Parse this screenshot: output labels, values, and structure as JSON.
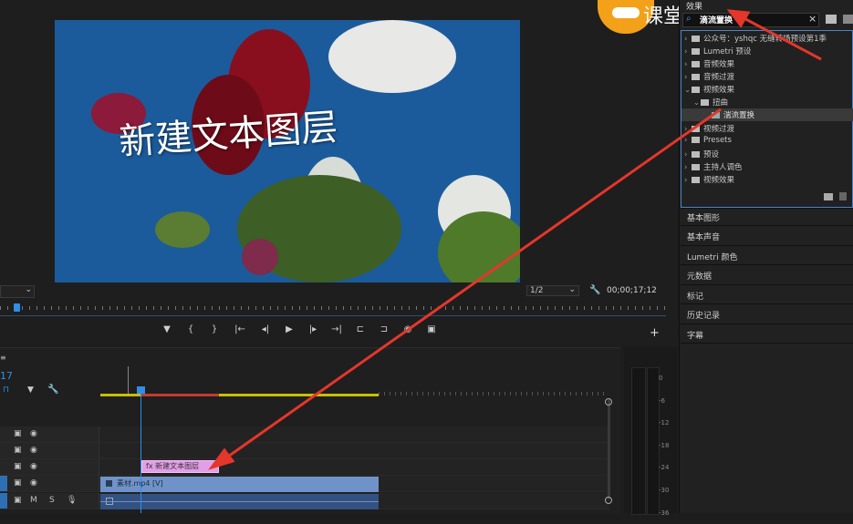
{
  "monitor": {
    "overlay_title": "新建文本图层",
    "zoom_left": "",
    "resolution": "1/2",
    "timecode": "00;00;17;12",
    "watermark_text": "课堂"
  },
  "transport": {
    "icons": [
      "marker-icon",
      "in-point-icon",
      "out-point-icon",
      "go-to-in-icon",
      "step-back-icon",
      "play-icon",
      "step-forward-icon",
      "go-to-out-icon",
      "lift-icon",
      "extract-icon",
      "export-frame-icon",
      "compare-icon"
    ],
    "add_label": "+"
  },
  "timeline": {
    "timecode_partial": "17",
    "tracks": [
      {
        "name": "V3"
      },
      {
        "name": "V2"
      },
      {
        "name": "V1"
      },
      {
        "name": "A1"
      }
    ],
    "title_clip_label": "新建文本图层",
    "video_clip_label": "素材.mp4 [V]",
    "audio_labels": {
      "m": "M",
      "s": "S"
    }
  },
  "meter": {
    "labels": [
      "0",
      "-6",
      "-12",
      "-18",
      "-24",
      "-30",
      "-36"
    ]
  },
  "effects_panel": {
    "tab_label": "效果",
    "search_value": "滴流置换",
    "clear_label": "×",
    "tree": [
      {
        "label": "公众号：yshqc 无缝转场预设第1季",
        "indent": 0,
        "expanded": false
      },
      {
        "label": "Lumetri 预设",
        "indent": 0,
        "expanded": false
      },
      {
        "label": "音频效果",
        "indent": 0,
        "expanded": false
      },
      {
        "label": "音频过渡",
        "indent": 0,
        "expanded": false
      },
      {
        "label": "视频效果",
        "indent": 0,
        "expanded": true
      },
      {
        "label": "扭曲",
        "indent": 1,
        "expanded": true
      },
      {
        "label": "湍流置换",
        "indent": 2,
        "expanded": false,
        "selected": true
      },
      {
        "label": "视频过渡",
        "indent": 0,
        "expanded": false
      },
      {
        "label": "Presets",
        "indent": 0,
        "expanded": false
      },
      {
        "label": "预设",
        "indent": 0,
        "expanded": false
      },
      {
        "label": "主持人调色",
        "indent": 0,
        "expanded": false
      },
      {
        "label": "视频效果",
        "indent": 0,
        "expanded": false
      }
    ],
    "panels": [
      "基本图形",
      "基本声音",
      "Lumetri 颜色",
      "元数据",
      "标记",
      "历史记录",
      "字幕"
    ]
  },
  "colors": {
    "accent": "#2f8ee8",
    "title_clip": "#e39ee8",
    "video_clip": "#6f93c9",
    "arrow": "#e5362b",
    "logo": "#f4a11a"
  }
}
